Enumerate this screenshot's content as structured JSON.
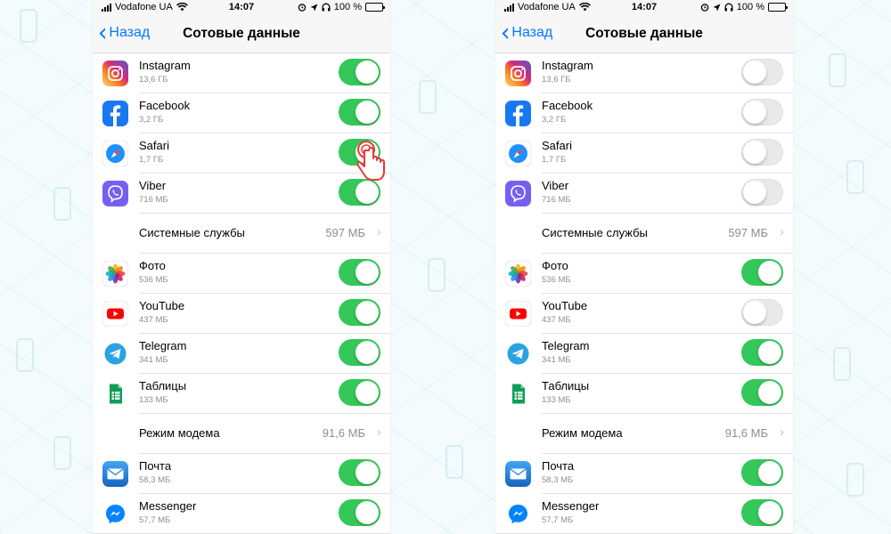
{
  "status_bar": {
    "carrier": "Vodafone UA",
    "time": "14:07",
    "battery": "100 %"
  },
  "nav": {
    "back_label": "Назад",
    "title": "Сотовые данные"
  },
  "colors": {
    "toggle_on": "#34c759",
    "toggle_off": "#e9e9ea",
    "link_blue": "#007aff",
    "instagram": "#c13584",
    "facebook": "#1877f2",
    "safari": "#1e90ff",
    "viber": "#7360f2",
    "youtube": "#ff0000",
    "telegram": "#2aa3e0",
    "sheets": "#0f9d58",
    "mail": "#1e88e5",
    "messenger": "#0084ff"
  },
  "screens": [
    {
      "items": [
        {
          "type": "app",
          "name": "Instagram",
          "size": "13,6 ГБ",
          "icon": "instagram-icon",
          "enabled": true
        },
        {
          "type": "app",
          "name": "Facebook",
          "size": "3,2 ГБ",
          "icon": "facebook-icon",
          "enabled": true
        },
        {
          "type": "app",
          "name": "Safari",
          "size": "1,7 ГБ",
          "icon": "safari-icon",
          "enabled": true,
          "tapped": true
        },
        {
          "type": "app",
          "name": "Viber",
          "size": "716 МБ",
          "icon": "viber-icon",
          "enabled": true
        },
        {
          "type": "system",
          "name": "Системные службы",
          "value": "597 МБ"
        },
        {
          "type": "app",
          "name": "Фото",
          "size": "536 МБ",
          "icon": "photos-icon",
          "enabled": true
        },
        {
          "type": "app",
          "name": "YouTube",
          "size": "437 МБ",
          "icon": "youtube-icon",
          "enabled": true
        },
        {
          "type": "app",
          "name": "Telegram",
          "size": "341 МБ",
          "icon": "telegram-icon",
          "enabled": true
        },
        {
          "type": "app",
          "name": "Таблицы",
          "size": "133 МБ",
          "icon": "sheets-icon",
          "enabled": true
        },
        {
          "type": "system",
          "name": "Режим модема",
          "value": "91,6 МБ"
        },
        {
          "type": "app",
          "name": "Почта",
          "size": "58,3 МБ",
          "icon": "mail-icon",
          "enabled": true
        },
        {
          "type": "app",
          "name": "Messenger",
          "size": "57,7 МБ",
          "icon": "messenger-icon",
          "enabled": true
        }
      ]
    },
    {
      "items": [
        {
          "type": "app",
          "name": "Instagram",
          "size": "13,6 ГБ",
          "icon": "instagram-icon",
          "enabled": false
        },
        {
          "type": "app",
          "name": "Facebook",
          "size": "3,2 ГБ",
          "icon": "facebook-icon",
          "enabled": false
        },
        {
          "type": "app",
          "name": "Safari",
          "size": "1,7 ГБ",
          "icon": "safari-icon",
          "enabled": false
        },
        {
          "type": "app",
          "name": "Viber",
          "size": "716 МБ",
          "icon": "viber-icon",
          "enabled": false
        },
        {
          "type": "system",
          "name": "Системные службы",
          "value": "597 МБ"
        },
        {
          "type": "app",
          "name": "Фото",
          "size": "536 МБ",
          "icon": "photos-icon",
          "enabled": true
        },
        {
          "type": "app",
          "name": "YouTube",
          "size": "437 МБ",
          "icon": "youtube-icon",
          "enabled": false
        },
        {
          "type": "app",
          "name": "Telegram",
          "size": "341 МБ",
          "icon": "telegram-icon",
          "enabled": true
        },
        {
          "type": "app",
          "name": "Таблицы",
          "size": "133 МБ",
          "icon": "sheets-icon",
          "enabled": true
        },
        {
          "type": "system",
          "name": "Режим модема",
          "value": "91,6 МБ"
        },
        {
          "type": "app",
          "name": "Почта",
          "size": "58,3 МБ",
          "icon": "mail-icon",
          "enabled": true
        },
        {
          "type": "app",
          "name": "Messenger",
          "size": "57,7 МБ",
          "icon": "messenger-icon",
          "enabled": true
        }
      ]
    }
  ]
}
